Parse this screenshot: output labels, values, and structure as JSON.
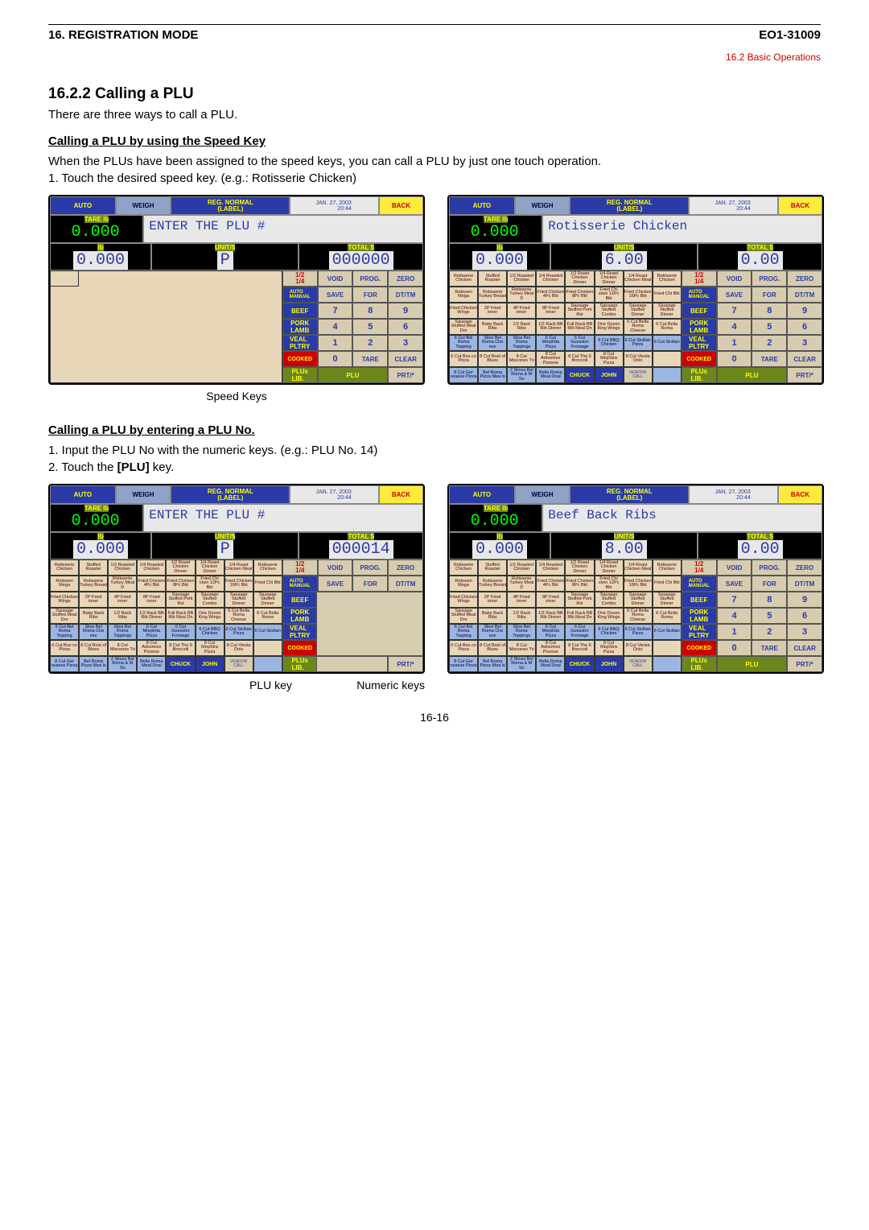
{
  "header": {
    "left": "16. REGISTRATION MODE",
    "right": "EO1-31009"
  },
  "basic_ops": "16.2 Basic Operations",
  "section_title": "16.2.2  Calling a PLU",
  "intro": "There are three ways to call a PLU.",
  "sub1": "Calling a PLU by using the Speed Key",
  "sub1_desc": "When the PLUs have been assigned to the speed keys, you can call a PLU by just one touch operation.",
  "sub1_step": "1. Touch the desired speed key. (e.g.: Rotisserie Chicken)",
  "caption_speed": "Speed Keys",
  "sub2": "Calling a PLU by entering a PLU No.",
  "sub2_step1": "1. Input the PLU No with the numeric keys. (e.g.: PLU No. 14)",
  "sub2_step2": "2. Touch the [PLU] key.",
  "caption_plu": "PLU key",
  "caption_num": "Numeric keys",
  "page_num": "16-16",
  "kiosk": {
    "auto": "AUTO",
    "weigh": "WEIGH",
    "reg": "REG. NORMAL\n(LABEL)",
    "date": "JAN. 27, 2003\n20:44",
    "back": "BACK",
    "tare_lbl": "TARE  lb",
    "tare_val": "0.000",
    "entry_prompt": "ENTER THE PLU #",
    "entry_rot": "Rotisserie Chicken",
    "entry_beef": "Beef Back Ribs",
    "lb_hdr": "lb",
    "lb_val": "0.000",
    "unit_hdr": "UNIT/$",
    "unit_p": "P",
    "unit_rot": "6.00",
    "unit_beef": "8.00",
    "total_hdr": "TOTAL  $",
    "total_zero": "000000",
    "total_14": "000014",
    "total_00": "0.00",
    "pad": {
      "frac12": "1/2",
      "frac14": "1/4",
      "void": "VOID",
      "prog": "PROG.",
      "zero": "ZERO",
      "auto": "AUTO\nMANUAL",
      "save": "SAVE",
      "for": "FOR",
      "dttm": "DT/TM",
      "beef": "BEEF",
      "pork": "PORK\nLAMB",
      "veal": "VEAL\nPLTRY",
      "cooked": "COOKED",
      "plus": "PLUs\nLIB.",
      "plu": "PLU",
      "prt": "PRT/*",
      "tare": "TARE",
      "clear": "CLEAR",
      "n": [
        "7",
        "8",
        "9",
        "4",
        "5",
        "6",
        "1",
        "2",
        "3",
        "0"
      ]
    },
    "speed": [
      "Rotisserie Chicken",
      "Stuffed Roaster",
      "1/2 Roasted Chicken",
      "1/4 Roasted Chicken",
      "1/2 Roast Chicken Dinner",
      "1/4 Roast Chicken Dinner",
      "1/4 Roast Chicken Meal",
      "Rotisserie Chicken",
      "Rotisseri Mega",
      "Rotisserie Turkey Breast",
      "Rotisserie Turkey Meal D",
      "Fried Chicken 4Pc Bkt",
      "Fried Chicken 8Pc Bkt",
      "Fried Chi cken 12Pc Bkt",
      "Fried Chicken 16Pc Bkt",
      "Fried Chi Bkt",
      "Fried Chicken Wings",
      "2P Fried inner",
      "4P Fried inner",
      "8P Fried inner",
      "Sausage Stuffed Pork Rst",
      "Sausage Stuffed Combo",
      "Sausage Stuffed Dinner",
      "Sausage Stuffed Dinner",
      "Sausage Stuffed Meal Dnr",
      "Baby Back Ribs",
      "1/2 Rack Ribs",
      "1/2 Rack BB Rib Dinner",
      "Full Rack BB Rib Meal Dn",
      "One Dozen King Wings",
      "6 Cut Bella Roma Cheese",
      "6 Cut Bella Roma",
      "6 Cut Bel Roma Topping",
      "Slice Bel Roma Che ese",
      "Slice Bel Roma Toppings",
      "6 Cut Morphita Pizza",
      "6 Cut Guesstro Fromage",
      "6 Cut BBQ Chicken",
      "6 Cut Sicilian Pizza",
      "6 Cut Sicilian",
      "6 Cut Bos co Pizza",
      "8 Cut Bost of Blues",
      "8 Cut Miscones Tri",
      "8 Cut Adosmice Pizzese",
      "8 Cut The 6 Broccoli",
      "8 Cut MepStra Pizza",
      "8 Cut Viesta Onio",
      "",
      "8 Cut Ger ovaese Pizza",
      "Bel Roma Pizza Mea ls",
      "2 Slices Bel Roma & M So",
      "Bella Roma Meal Dnal",
      "CHUCK",
      "JOHN",
      "VENDOR CALL",
      ""
    ]
  }
}
